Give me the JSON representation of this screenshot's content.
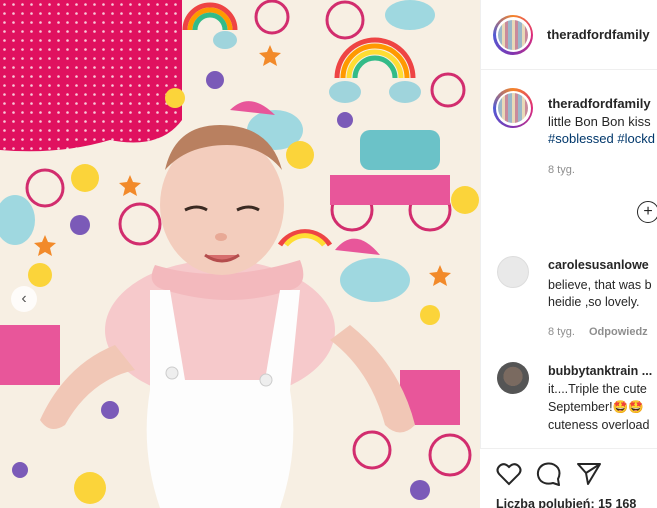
{
  "post": {
    "username": "theradfordfamily",
    "caption": "little Bon Bon kiss",
    "hashtags": "#soblessed #lockd",
    "time": "8 tyg."
  },
  "comments": [
    {
      "username": "carolesusanlowe",
      "lines": [
        "believe, that was b",
        "heidie ,so lovely."
      ],
      "time": "8 tyg.",
      "reply": "Odpowiedz"
    },
    {
      "username": "bubbytanktrain ...",
      "lines": [
        "it....Triple the cute",
        "September!🤩🤩",
        "cuteness overload"
      ]
    }
  ],
  "likes": "Liczba polubień: 15 168",
  "icons": {
    "prev": "chevron-left-icon",
    "add": "plus-circle-icon",
    "like": "heart-icon",
    "comment": "comment-icon",
    "share": "share-icon"
  },
  "colors": {
    "pink_pillow": "#e0115f",
    "link": "#00376b",
    "muted": "#8e8e8e"
  }
}
